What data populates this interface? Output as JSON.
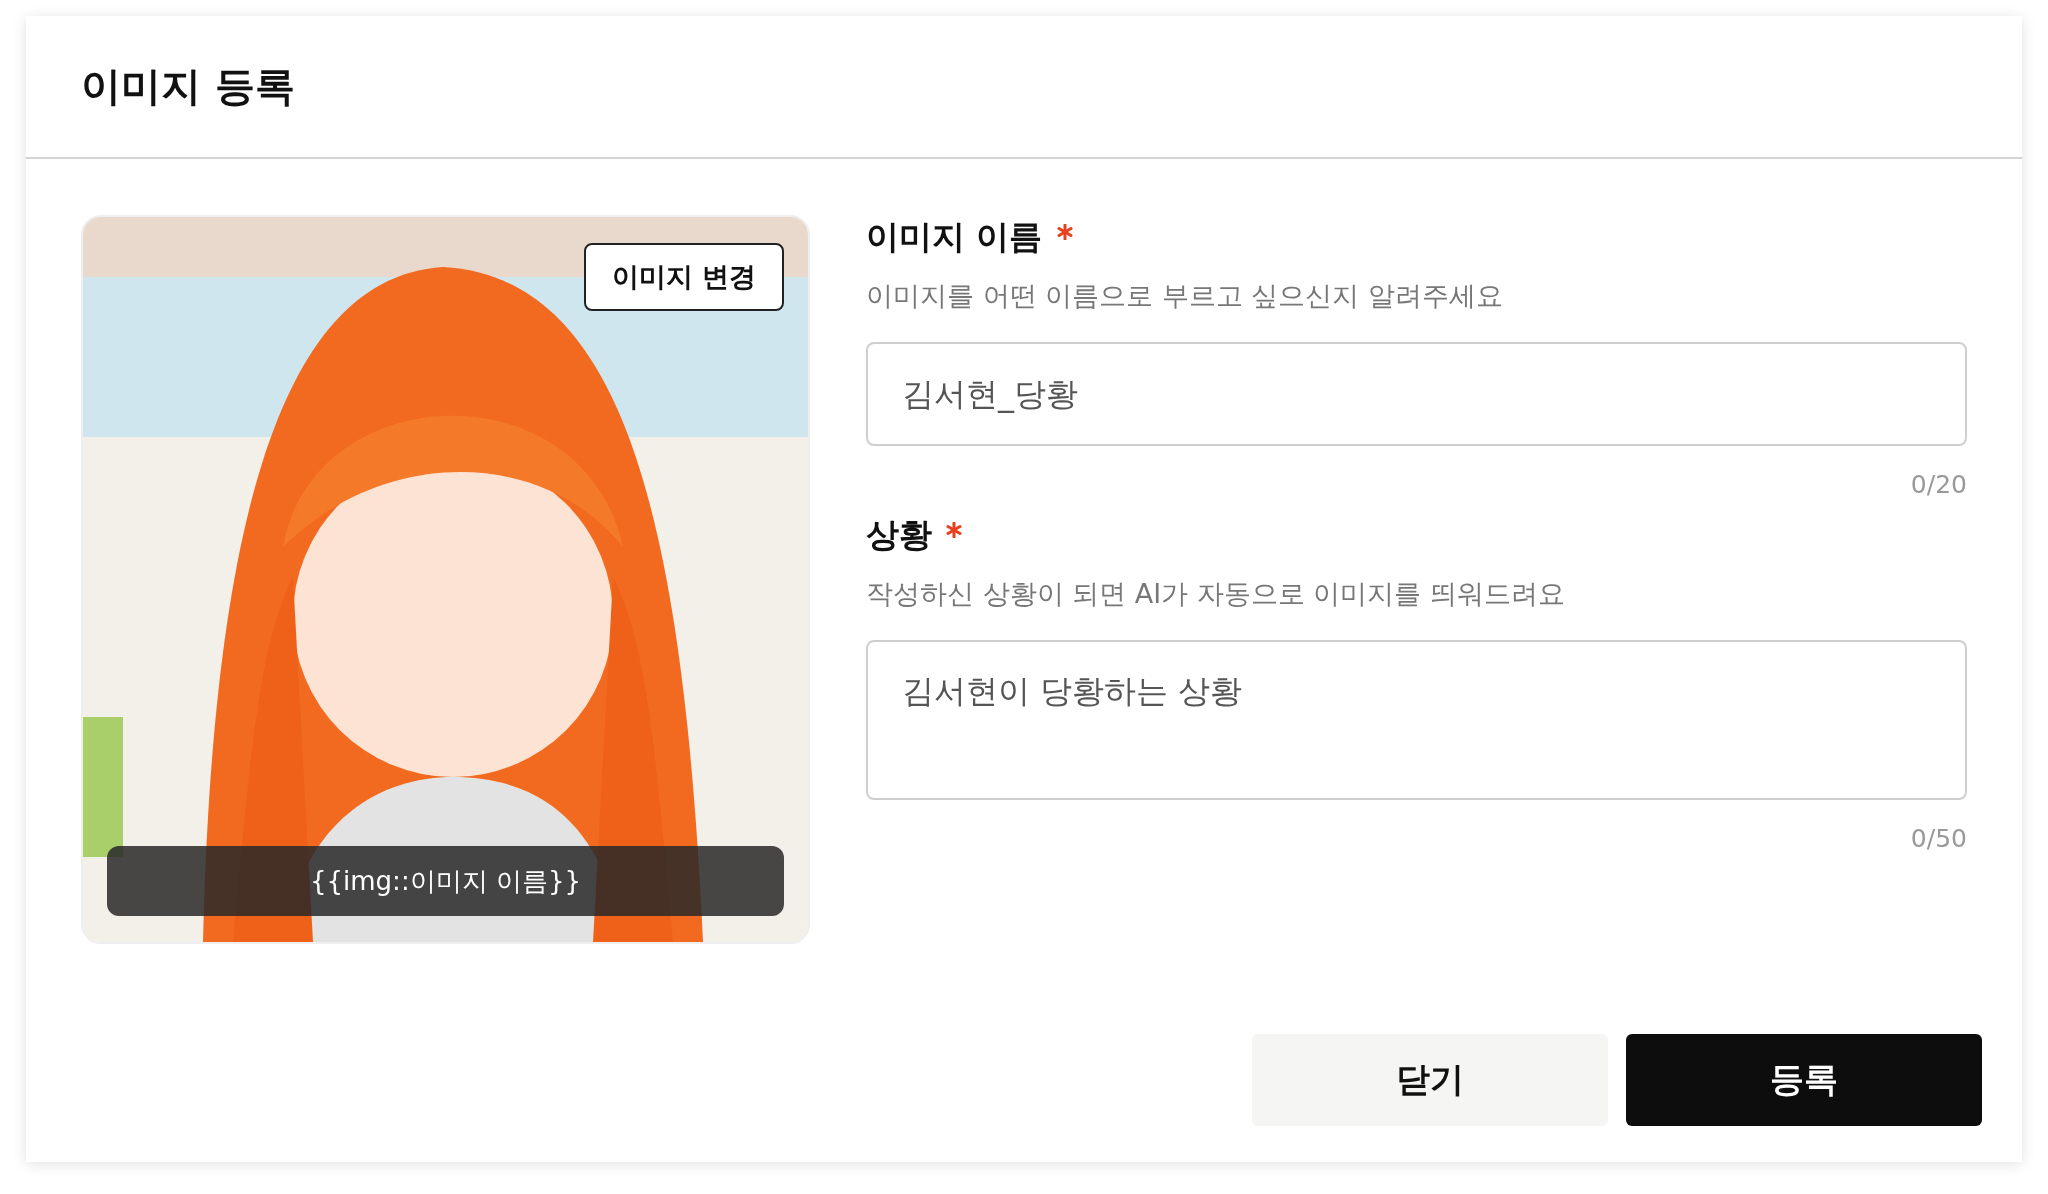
{
  "dialog": {
    "title": "이미지 등록"
  },
  "image": {
    "kind": "picture",
    "change_button": "이미지 변경",
    "caption": "{{img::이미지 이름}}"
  },
  "fields": [
    {
      "kind": "input",
      "label": "이미지 이름",
      "required": true,
      "hint": "이미지를 어떤 이름으로 부르고 싶으신지 알려주세요",
      "placeholder": "김서현_당황",
      "counter": "0/20"
    },
    {
      "kind": "textarea",
      "label": "상황",
      "required": true,
      "hint": "작성하신 상황이 되면 AI가 자동으로 이미지를 띄워드려요",
      "placeholder": "김서현이 당황하는 상황",
      "counter": "0/50"
    }
  ],
  "buttons": [
    {
      "label": "닫기",
      "primary": false
    },
    {
      "label": "등록",
      "primary": true
    }
  ]
}
